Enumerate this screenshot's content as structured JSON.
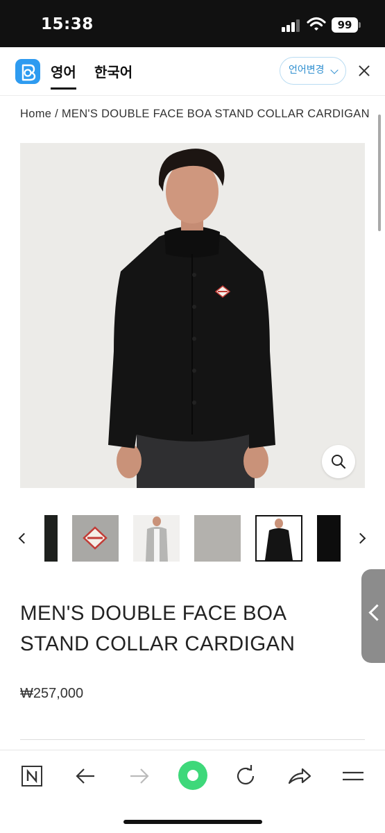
{
  "status_bar": {
    "time": "15:38",
    "battery": "99"
  },
  "translate_bar": {
    "source_lang": "영어",
    "target_lang": "한국어",
    "change_button": "언어변경"
  },
  "breadcrumb": "Home / MEN'S DOUBLE FACE BOA STAND COLLAR CARDIGAN",
  "product": {
    "title_line1": "MEN'S DOUBLE FACE BOA",
    "title_line2": "STAND COLLAR CARDIGAN",
    "price": "₩257,000",
    "selected_thumbnail": 5,
    "thumbnail_count": 6
  },
  "colors": {
    "papago_blue": "#2e9bf0",
    "toolbar_green": "#3ed87a",
    "jacket_black": "#141414"
  },
  "icons": {
    "papago": "papago-logo-icon",
    "close": "close-icon",
    "zoom": "search-icon",
    "prev": "chevron-left-icon",
    "next": "chevron-right-icon",
    "naver": "naver-n-icon",
    "back": "arrow-left-icon",
    "forward": "arrow-right-icon",
    "green_dot": "green-dot-icon",
    "refresh": "refresh-icon",
    "share": "share-icon",
    "menu": "menu-icon"
  }
}
